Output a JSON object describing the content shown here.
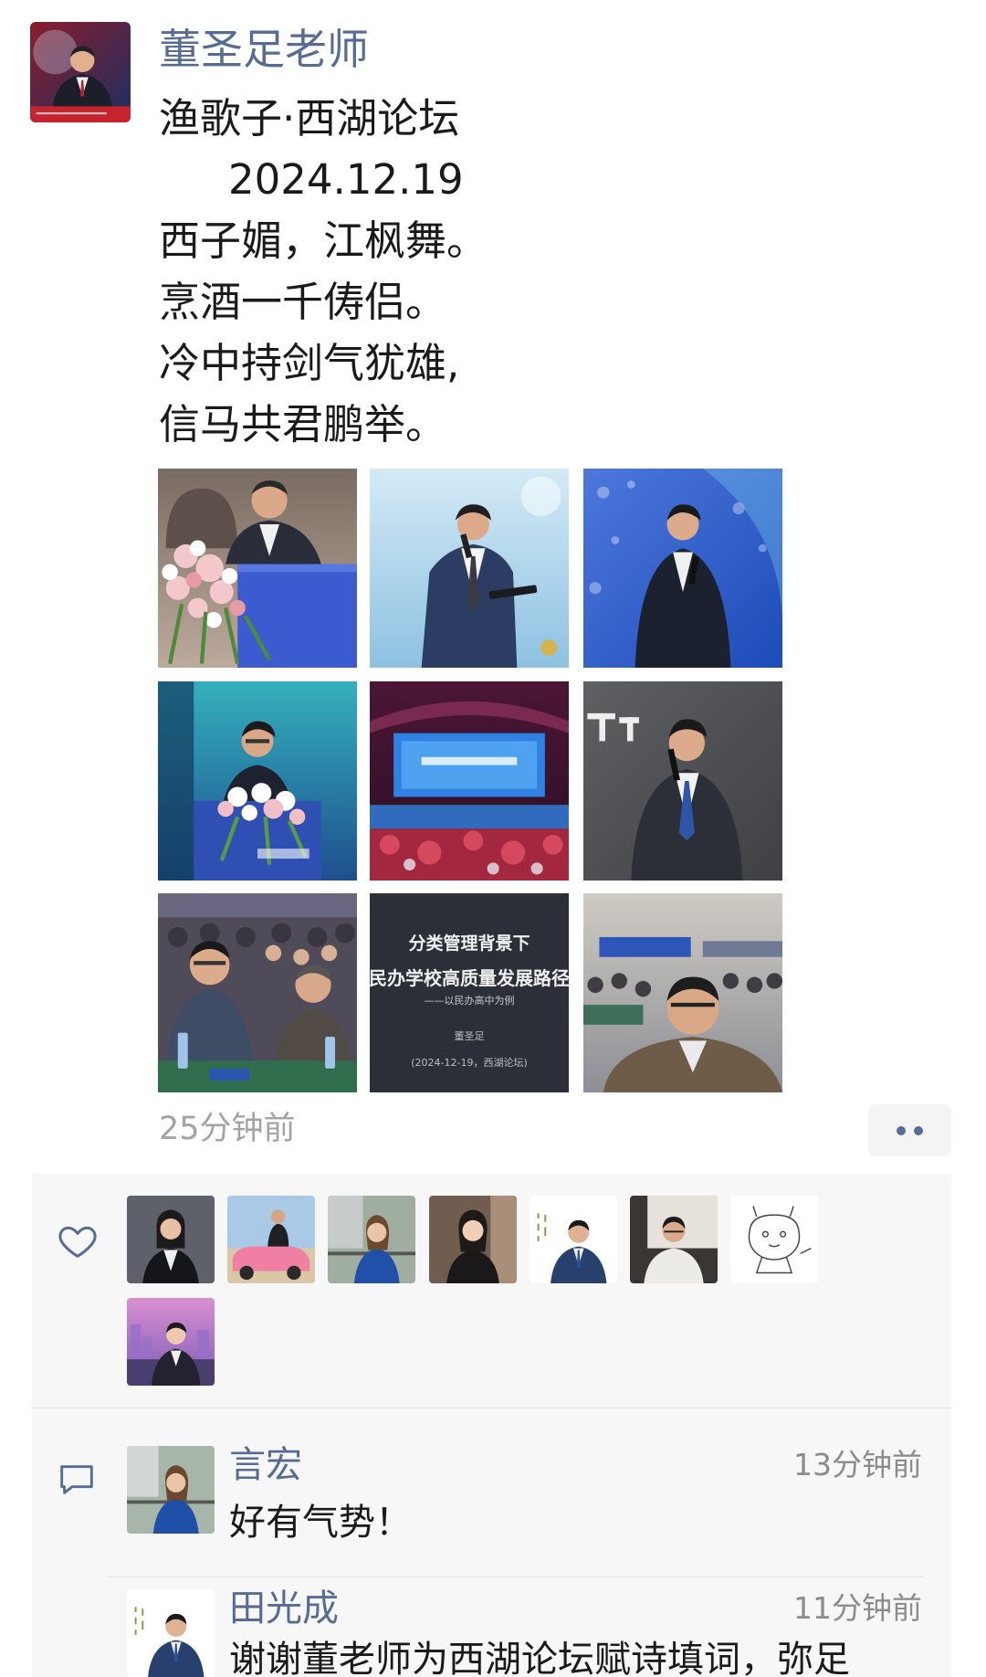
{
  "post": {
    "author": "董圣足老师",
    "poem_lines": [
      "渔歌子·西湖论坛",
      "2024.12.19",
      "西子媚，江枫舞。",
      "烹酒一千俦侣。",
      "冷中持剑气犹雄,",
      "信马共君鹏举。"
    ],
    "slide_text": [
      "分类管理背景下",
      "民办学校高质量发展路径",
      "——以民办高中为例",
      "董圣足",
      "(2024-12-19，西湖论坛)"
    ],
    "time": "25分钟前",
    "more_icon": "more-dots-icon"
  },
  "likes": {
    "icon": "heart-icon"
  },
  "comments_icon": "comment-bubble-icon",
  "comments": [
    {
      "name": "言宏",
      "time": "13分钟前",
      "text": "好有气势！"
    },
    {
      "name": "田光成",
      "time": "11分钟前",
      "text": "谢谢董老师为西湖论坛赋诗填词，弥足"
    }
  ],
  "colors": {
    "link_blue": "#576b95",
    "timestamp_gray": "#a3a3a3",
    "panel_bg": "#f7f7f7"
  }
}
